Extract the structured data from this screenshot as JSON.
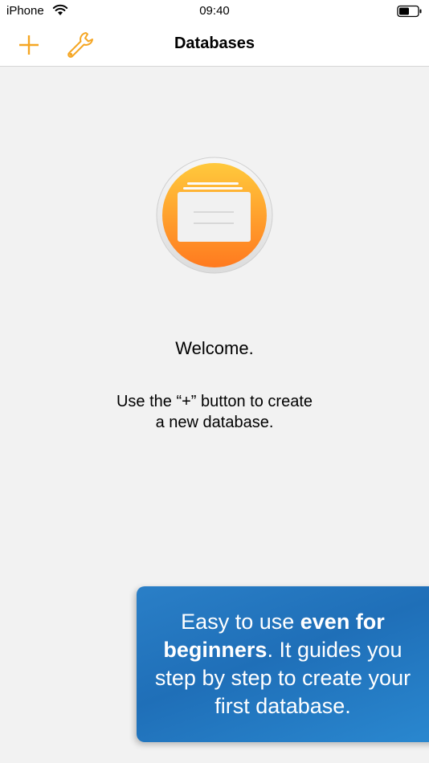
{
  "status_bar": {
    "carrier": "iPhone",
    "time": "09:40"
  },
  "nav": {
    "title": "Databases",
    "add_icon": "plus-icon",
    "settings_icon": "wrench-icon"
  },
  "empty_state": {
    "icon": "database-stack-icon",
    "welcome": "Welcome.",
    "instruction_line1": "Use the “+” button to create",
    "instruction_line2": "a new database."
  },
  "promo": {
    "part1": "Easy to use ",
    "part2_bold": "even for",
    "part3_bold": "beginners",
    "part4": ". It guides you step by step to create your first database."
  },
  "colors": {
    "accent": "#f5a623",
    "banner": "#2a7fc7",
    "background": "#f2f2f2"
  }
}
